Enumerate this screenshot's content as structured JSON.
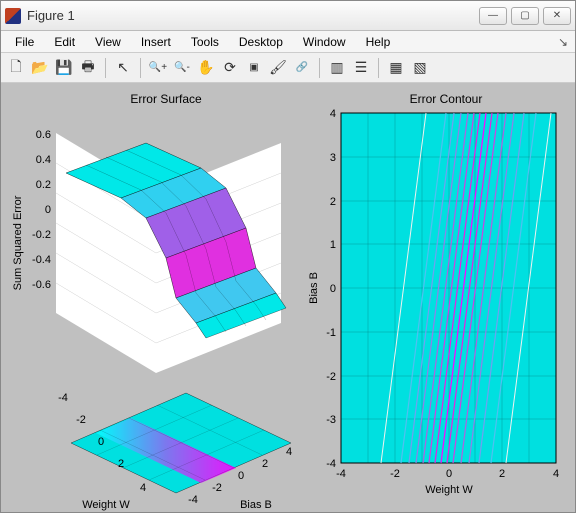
{
  "window": {
    "title": "Figure 1",
    "minimize_glyph": "—",
    "maximize_glyph": "▢",
    "close_glyph": "✕"
  },
  "menu": {
    "items": [
      "File",
      "Edit",
      "View",
      "Insert",
      "Tools",
      "Desktop",
      "Window",
      "Help"
    ]
  },
  "toolbar": {
    "new": "🗋",
    "open": "📂",
    "save": "💾",
    "print": "🖶",
    "pointer": "↖",
    "zoomin": "🔍+",
    "zoomout": "🔍-",
    "pan": "✋",
    "rotate": "⟳",
    "datacursor": "▣",
    "brush": "🖌",
    "link": "🔗",
    "colorbar": "▥",
    "legend": "☰",
    "hideplot": "▦",
    "showplot": "▧"
  },
  "chart_data": [
    {
      "type": "surface3d_with_projection",
      "title": "Error Surface",
      "xlabel": "Weight W",
      "ylabel": "Bias B",
      "zlabel": "Sum Squared Error",
      "x_range": [
        -4,
        4
      ],
      "y_range": [
        -4,
        4
      ],
      "z_range": [
        -0.6,
        0.6
      ],
      "z_ticks": [
        -0.6,
        -0.4,
        -0.2,
        0,
        0.2,
        0.4,
        0.6
      ],
      "xy_ticks": [
        -4,
        -2,
        0,
        2,
        4
      ],
      "colormap": "cool",
      "description": "Smooth sigmoid-like surface transitioning from ~+0.6 at W=-4 to ~-0.6 at W=+4, with inflection near W≈0 shifted by bias B; floor shows color projection of same data."
    },
    {
      "type": "contour",
      "title": "Error Contour",
      "xlabel": "Weight W",
      "ylabel": "Bias B",
      "x_range": [
        -4,
        4
      ],
      "y_range": [
        -4,
        4
      ],
      "x_ticks": [
        -4,
        -2,
        0,
        2,
        4
      ],
      "y_ticks": [
        -4,
        -3,
        -2,
        -1,
        0,
        1,
        2,
        3,
        4
      ],
      "colormap": "cool",
      "background": "#00e0e0",
      "description": "Near-vertical, slightly slanted contour band centered around W≈0–1, dense magenta-to-cyan isolines; flat cyan regions on left and right."
    }
  ]
}
